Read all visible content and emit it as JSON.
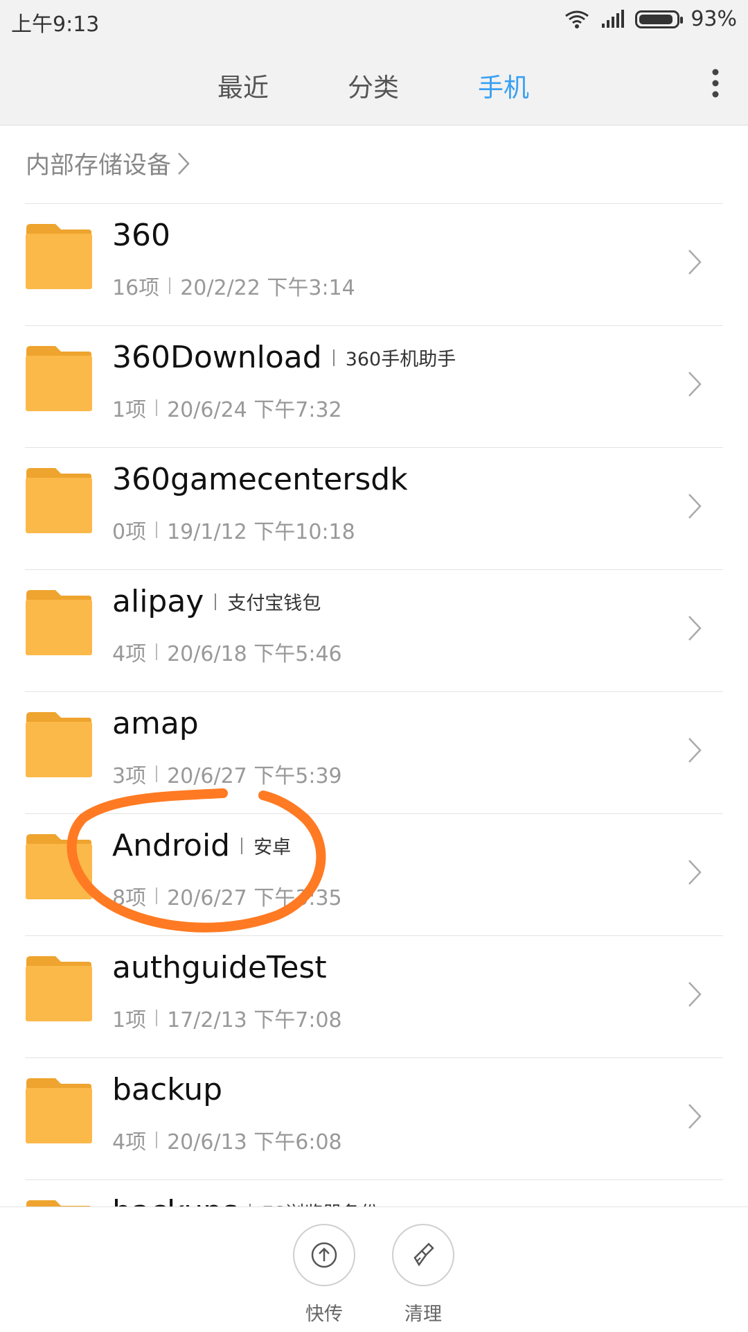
{
  "status": {
    "time": "上午9:13",
    "battery": "93%",
    "battery_level": 0.93
  },
  "tabs": [
    {
      "label": "最近",
      "active": false
    },
    {
      "label": "分类",
      "active": false
    },
    {
      "label": "手机",
      "active": true
    }
  ],
  "breadcrumb": {
    "label": "内部存储设备"
  },
  "folders": [
    {
      "name": "360",
      "tag": "",
      "count": "16项",
      "date": "20/2/22 下午3:14"
    },
    {
      "name": "360Download",
      "tag": "360手机助手",
      "count": "1项",
      "date": "20/6/24 下午7:32"
    },
    {
      "name": "360gamecentersdk",
      "tag": "",
      "count": "0项",
      "date": "19/1/12 下午10:18"
    },
    {
      "name": "alipay",
      "tag": "支付宝钱包",
      "count": "4项",
      "date": "20/6/18 下午5:46"
    },
    {
      "name": "amap",
      "tag": "",
      "count": "3项",
      "date": "20/6/27 下午5:39"
    },
    {
      "name": "Android",
      "tag": "安卓",
      "count": "8项",
      "date": "20/6/27 下午3:35"
    },
    {
      "name": "authguideTest",
      "tag": "",
      "count": "1项",
      "date": "17/2/13 下午7:08"
    },
    {
      "name": "backup",
      "tag": "",
      "count": "4项",
      "date": "20/6/13 下午6:08"
    },
    {
      "name": "backups",
      "tag": "ES浏览器备份",
      "count": "",
      "date": ""
    }
  ],
  "bottom_actions": [
    {
      "label": "快传",
      "icon": "upload-icon"
    },
    {
      "label": "清理",
      "icon": "broom-icon"
    }
  ],
  "colors": {
    "accent": "#3aa0f3",
    "folder": "#fbb94a",
    "folder_tab": "#eea42e",
    "annotation": "#ff7a22"
  }
}
